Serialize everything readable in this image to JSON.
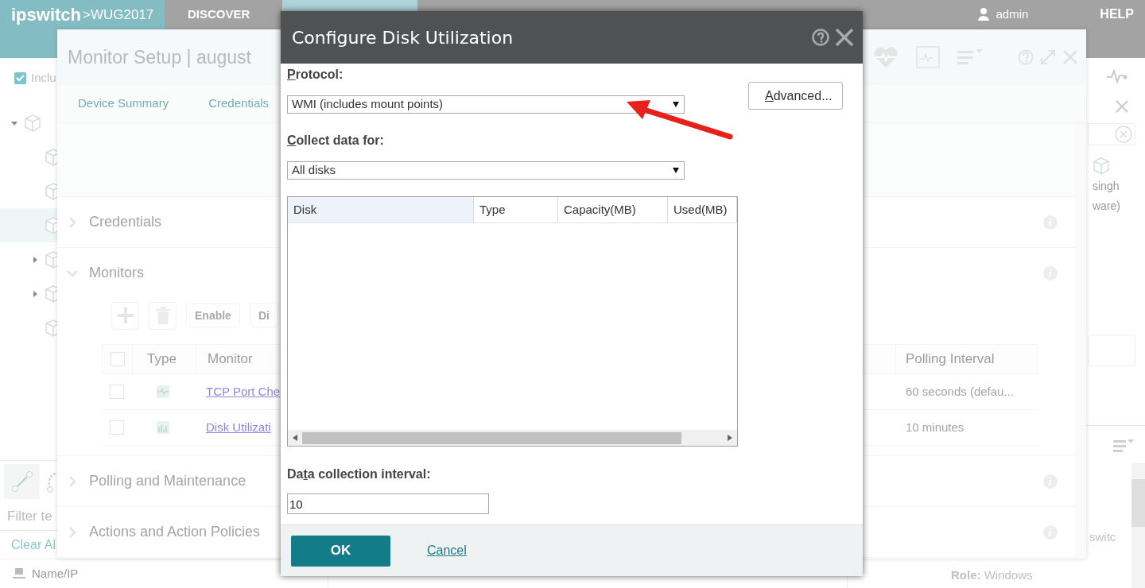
{
  "top_bar": {
    "logo": "ipswitch",
    "product": ">WUG2017",
    "nav": [
      "DISCOVER"
    ],
    "user": "admin",
    "help": "HELP"
  },
  "left_panel": {
    "include_checkbox": {
      "label": "Inclu",
      "checked": true
    },
    "tree": [
      {
        "expanded": true,
        "selected": false,
        "children": [
          {
            "selected": false
          },
          {
            "selected": false
          },
          {
            "selected": true
          },
          {
            "expanded": false,
            "selected": false
          },
          {
            "expanded": false,
            "selected": false
          },
          {
            "selected": false
          }
        ]
      }
    ],
    "filter": {
      "placeholder": "Filter te"
    },
    "clear_link": "Clear Al",
    "column": "Name/IP"
  },
  "right_panel": {
    "device_lines": [
      "singh",
      "ware)"
    ],
    "list_fragment": "switc",
    "role_label": "Role:",
    "role_value": "Windows"
  },
  "monitor_setup": {
    "title": "Monitor Setup | august",
    "tabs": [
      {
        "label": "Device Summary",
        "selected": false
      },
      {
        "label": "Credentials",
        "selected": false
      }
    ],
    "sections": [
      {
        "title": "Credentials",
        "expanded": false
      },
      {
        "title": "Monitors",
        "expanded": true
      },
      {
        "title": "Polling and Maintenance",
        "expanded": false
      },
      {
        "title": "Actions and Action Policies",
        "expanded": false
      }
    ],
    "toolbar": [
      "Enable",
      "Di"
    ],
    "all_checked": false,
    "columns": [
      "Type",
      "Monitor",
      "Polling Interval"
    ],
    "rows": [
      {
        "checked": false,
        "monitor": "TCP Port Che",
        "polling_interval": "60 seconds (defau..."
      },
      {
        "checked": false,
        "monitor": "Disk Utilizati",
        "polling_interval": "10 minutes"
      }
    ]
  },
  "dialog": {
    "title": "Configure Disk Utilization",
    "protocol": {
      "label": "Protocol:",
      "value": "WMI (includes mount points)"
    },
    "advanced": {
      "label": "Advanced..."
    },
    "collect": {
      "label": "Collect data for:",
      "value": "All disks"
    },
    "columns": [
      {
        "label": "Disk",
        "selected": true
      },
      {
        "label": "Type",
        "selected": false
      },
      {
        "label": "Capacity(MB)",
        "selected": false
      },
      {
        "label": "Used(MB)",
        "selected": false
      }
    ],
    "interval": {
      "label": "Data collection interval:",
      "value": "10"
    },
    "ok": "OK",
    "cancel": "Cancel"
  }
}
